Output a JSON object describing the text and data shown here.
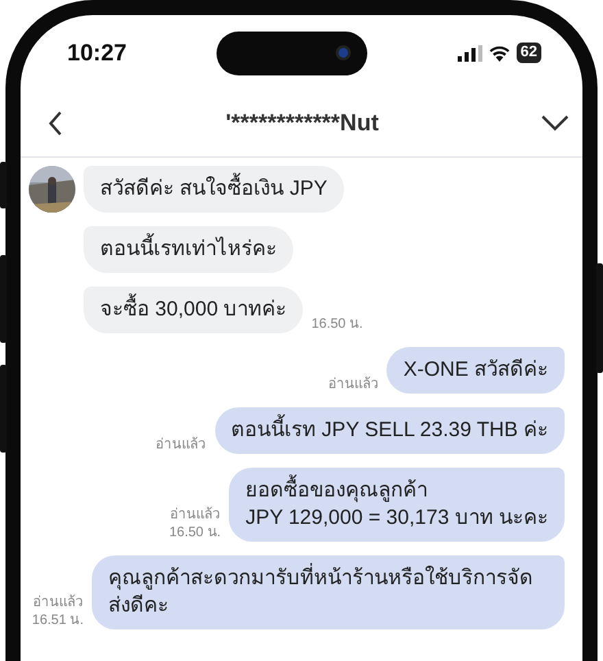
{
  "status_bar": {
    "time": "10:27",
    "battery": "62"
  },
  "header": {
    "title": "'************Nut"
  },
  "messages": [
    {
      "kind": "incoming",
      "avatar": true,
      "text": "สวัสดีค่ะ สนใจซื้อเงิน JPY"
    },
    {
      "kind": "incoming",
      "avatar": false,
      "text": "ตอนนี้เรทเท่าไหร่คะ"
    },
    {
      "kind": "incoming",
      "avatar": false,
      "text": "จะซื้อ 30,000 บาทค่ะ",
      "time": "16.50 น."
    },
    {
      "kind": "outgoing",
      "text": "X-ONE สวัสดีค่ะ",
      "read": "อ่านแล้ว"
    },
    {
      "kind": "outgoing",
      "text": "ตอนนี้เรท JPY SELL 23.39 THB ค่ะ",
      "read": "อ่านแล้ว"
    },
    {
      "kind": "outgoing",
      "text": "ยอดซื้อของคุณลูกค้า\nJPY 129,000 = 30,173 บาท นะคะ",
      "read": "อ่านแล้ว",
      "time": "16.50 น."
    },
    {
      "kind": "outgoing",
      "text": "คุณลูกค้าสะดวกมารับที่หน้าร้านหรือใช้บริการจัดส่งดีคะ",
      "read": "อ่านแล้ว",
      "time": "16.51 น."
    }
  ]
}
